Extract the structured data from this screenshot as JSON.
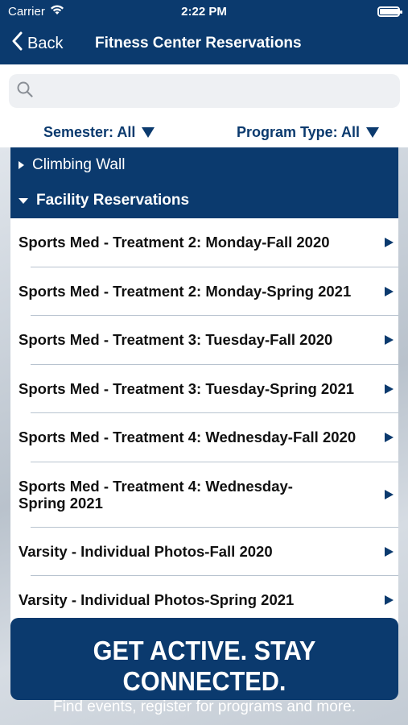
{
  "status_bar": {
    "carrier": "Carrier",
    "time": "2:22 PM",
    "battery_level": 1.0
  },
  "nav": {
    "back_label": "Back",
    "title": "Fitness Center Reservations"
  },
  "search": {
    "placeholder": "",
    "value": ""
  },
  "filters": {
    "semester": "Semester: All",
    "program_type": "Program Type: All"
  },
  "categories": [
    {
      "label": "Climbing Wall",
      "expanded": false
    },
    {
      "label": "Facility Reservations",
      "expanded": true
    }
  ],
  "items": [
    "Sports Med - Treatment 2: Monday-Fall 2020",
    "Sports Med - Treatment 2: Monday-Spring 2021",
    "Sports Med - Treatment 3: Tuesday-Fall 2020",
    "Sports Med - Treatment 3: Tuesday-Spring 2021",
    "Sports Med - Treatment 4: Wednesday-Fall 2020",
    "Sports Med - Treatment 4: Wednesday-Spring 2021",
    "Varsity - Individual Photos-Fall 2020",
    "Varsity - Individual Photos-Spring 2021"
  ],
  "banner": {
    "headline": "GET ACTIVE.  STAY CONNECTED.",
    "subtext": "Find events, register for programs and more."
  },
  "colors": {
    "primary": "#0b3a6e",
    "text": "#111111"
  },
  "icons": [
    "wifi-icon",
    "battery-icon",
    "chevron-left-icon",
    "search-icon",
    "caret-down-icon",
    "caret-right-icon",
    "arrow-right-icon"
  ]
}
